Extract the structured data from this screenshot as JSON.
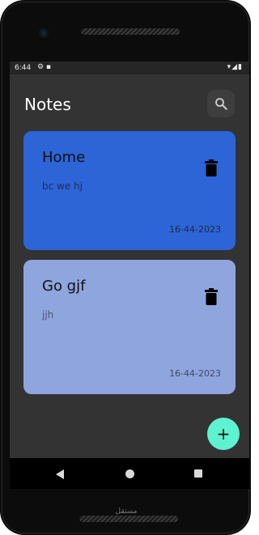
{
  "status_bar": {
    "time": "6:44",
    "left_icons": "⚙ ▪",
    "right_icons": "▾◢▮"
  },
  "app": {
    "title": "Notes"
  },
  "notes": [
    {
      "title": "Home",
      "body": "bc we hj",
      "date": "16-44-2023",
      "color": "#2d64d6"
    },
    {
      "title": "Go gjf",
      "body": "jjh",
      "date": "16-44-2023",
      "color": "#8fa5dd"
    }
  ],
  "fab": {
    "label": "+",
    "color": "#5ff2d0"
  },
  "icons": {
    "search": "search-icon",
    "delete": "trash-icon",
    "add": "plus-icon"
  },
  "watermark": {
    "text": "مستقل"
  }
}
